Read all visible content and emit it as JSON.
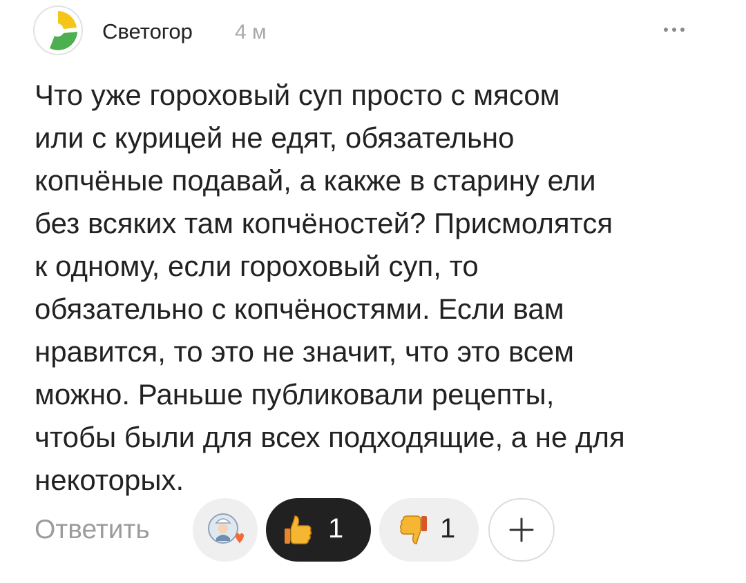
{
  "comment": {
    "author": "Светогор",
    "time": "4 м",
    "avatar_icon": "yellow-green-circle-avatar",
    "text_lines": [
      "Что уже гороховый суп просто с мясом",
      "или с курицей не едят, обязательно",
      "копчёные подавай, а какже в старину ели",
      "без всяких там копчёностей? Присмолятся",
      "к одному, если гороховый суп, то",
      "обязательно с копчёностями. Если вам",
      "нравится, то это не значит, что это всем",
      "можно. Раньше публиковали рецепты,",
      "чтобы были для всех подходящие, а не для",
      "некоторых."
    ]
  },
  "actions": {
    "reply_label": "Ответить",
    "like_count": "1",
    "dislike_count": "1",
    "add_reaction_icon": "plus-icon"
  },
  "colors": {
    "like_bg": "#212121",
    "pill_bg": "#efefef",
    "avatar_yellow": "#f5c518",
    "avatar_green": "#4caf50"
  }
}
